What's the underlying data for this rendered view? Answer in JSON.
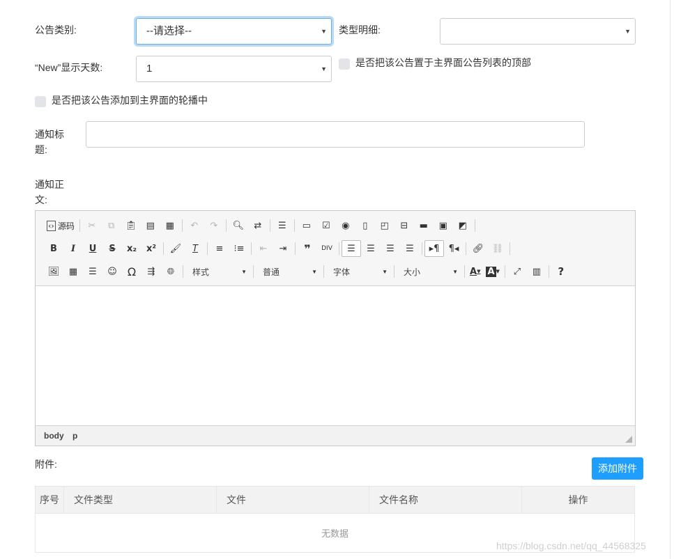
{
  "form": {
    "category_label": "公告类别:",
    "category_value": "--请选择--",
    "type_detail_label": "类型明细:",
    "type_detail_value": "",
    "new_days_label": "“New”显示天数:",
    "new_days_value": "1",
    "pin_top_label": "是否把该公告置于主界面公告列表的顶部",
    "carousel_label": "是否把该公告添加到主界面的轮播中",
    "title_label_1": "通知标",
    "title_label_2": "题:",
    "title_value": "",
    "body_label_1": "通知正",
    "body_label_2": "文:"
  },
  "editor": {
    "source_label": "源码",
    "combos": [
      "样式",
      "普通",
      "字体",
      "大小"
    ],
    "path": [
      "body",
      "p"
    ]
  },
  "attachments": {
    "label": "附件:",
    "add_button": "添加附件",
    "columns": [
      "序号",
      "文件类型",
      "文件",
      "文件名称",
      "操作"
    ],
    "empty_text": "无数据"
  },
  "watermark": "https://blog.csdn.net/qq_44568325",
  "colors": {
    "accent": "#1e9fff",
    "focus_border": "#66afe9"
  }
}
